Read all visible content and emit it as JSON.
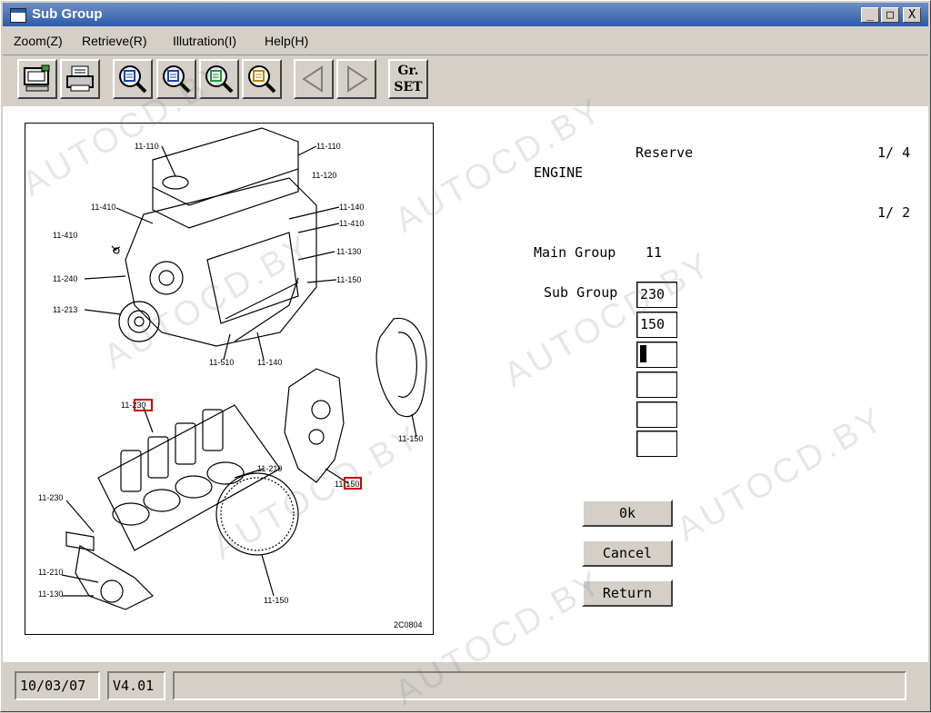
{
  "window": {
    "title": "Sub Group",
    "controls": {
      "minimize": "_",
      "maximize": "□",
      "close": "X"
    }
  },
  "menu": [
    "Zoom(Z)",
    "Retrieve(R)",
    "Illutration(I)",
    "Help(H)"
  ],
  "toolbar": {
    "grset_line1": "Gr.",
    "grset_line2": "SET",
    "buttons": [
      "monitor-icon",
      "printer-icon",
      "zoom-icon-1",
      "zoom-icon-2",
      "zoom-icon-3",
      "zoom-icon-4",
      "arrow-left-icon",
      "arrow-right-icon",
      "grset-button"
    ]
  },
  "illustration": {
    "labels": {
      "l1": "11-110",
      "l2": "11-110",
      "l3": "11-120",
      "l4": "11-410",
      "l5": "11-140",
      "l6": "11-410",
      "l7": "11-410",
      "l8": "11-130",
      "l9": "11-240",
      "l10": "11-150",
      "l11": "11-213",
      "l12": "11-510",
      "l13": "11-140",
      "l14": "11-230",
      "l15": "11-210",
      "l16": "11-150",
      "l17": "11-230",
      "l18": "11-210",
      "l19": "11-150",
      "l20": "11-130",
      "l21": "11-150",
      "l22": "11-150",
      "code": "2C0804"
    }
  },
  "form": {
    "reserve_label": "Reserve",
    "page1": "1/ 4",
    "engine_label": "ENGINE",
    "page2": "1/ 2",
    "main_group_label": "Main Group",
    "main_group_value": "11",
    "sub_group_label": "Sub Group",
    "sub_group_values": [
      "230",
      "150",
      "",
      "",
      "",
      ""
    ]
  },
  "buttons": {
    "ok": "0k",
    "cancel": "Cancel",
    "return": "Return"
  },
  "status": {
    "date": "10/03/07",
    "version": "V4.01",
    "message": ""
  },
  "watermark": "AUTOCD.BY"
}
